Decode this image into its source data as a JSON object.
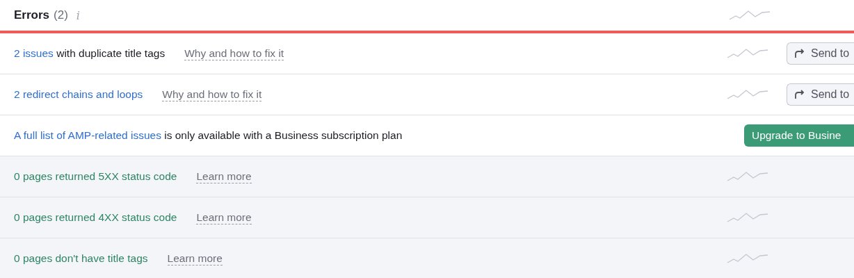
{
  "header": {
    "title": "Errors",
    "count": "(2)",
    "info_icon": "i"
  },
  "rows": [
    {
      "kind": "issue",
      "link": "2 issues",
      "text": " with duplicate title tags",
      "help": "Why and how to fix it",
      "action": "Send to"
    },
    {
      "kind": "issue",
      "link": "2 redirect chains and loops",
      "text": "",
      "help": "Why and how to fix it",
      "action": "Send to"
    },
    {
      "kind": "upgrade",
      "link": "A full list of AMP-related issues",
      "text": " is only available with a Business subscription plan",
      "action": "Upgrade to Busine"
    },
    {
      "kind": "ok",
      "text": "0 pages returned 5XX status code",
      "help": "Learn more"
    },
    {
      "kind": "ok",
      "text": "0 pages returned 4XX status code",
      "help": "Learn more"
    },
    {
      "kind": "ok",
      "text": "0 pages don't have title tags",
      "help": "Learn more"
    }
  ]
}
